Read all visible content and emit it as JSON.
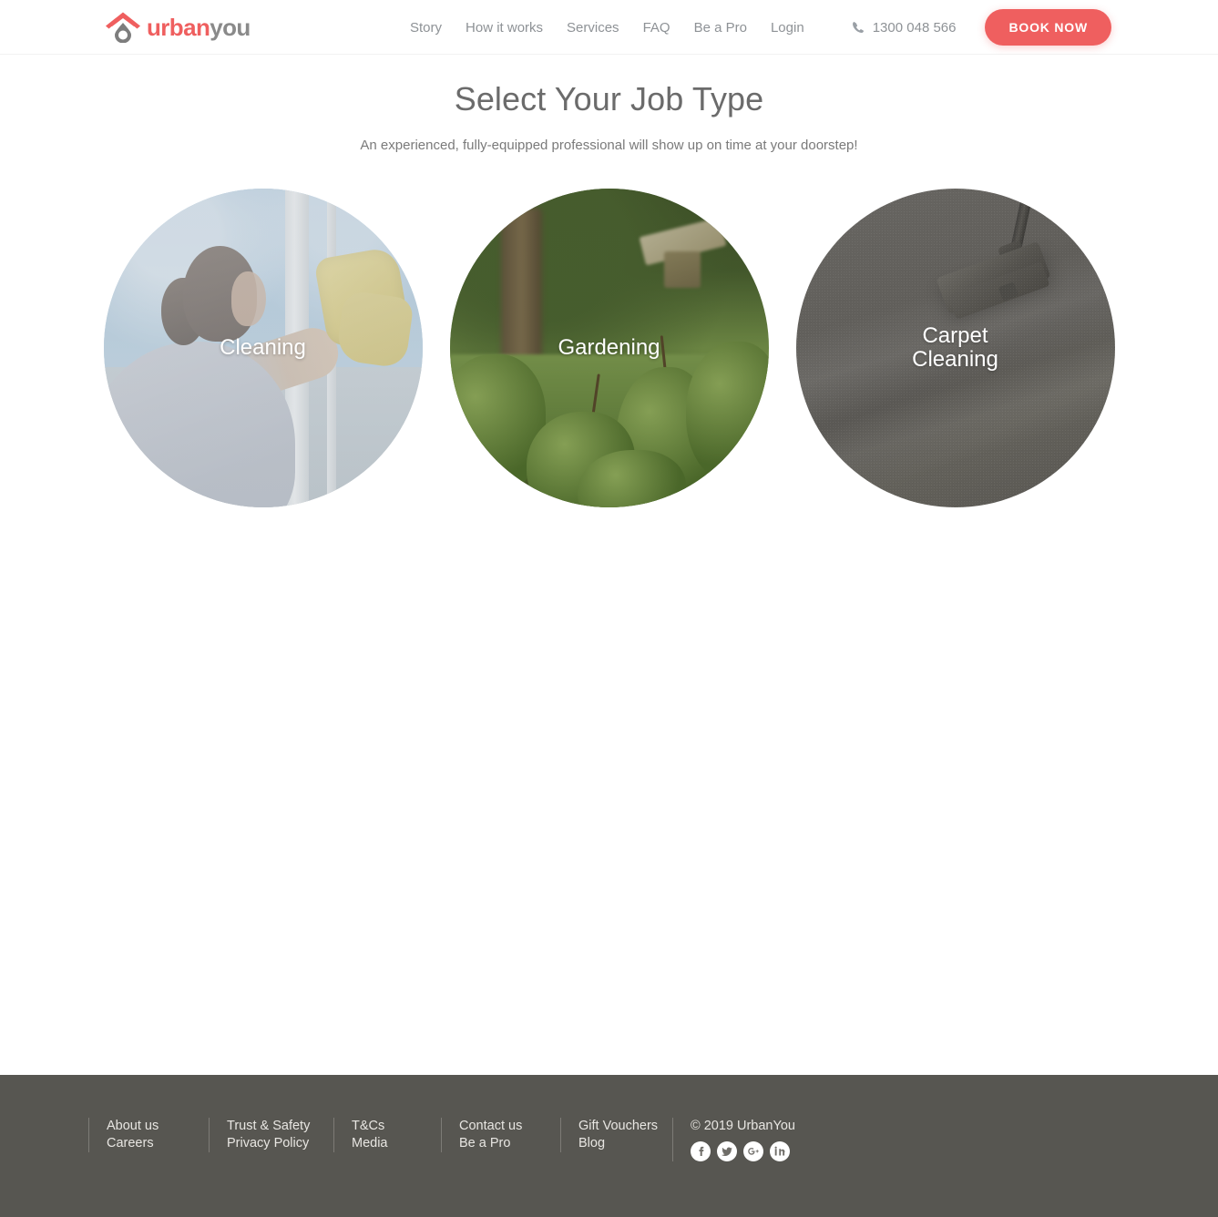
{
  "header": {
    "logo": {
      "brand_part1": "urban",
      "brand_part2": "you",
      "alt": "UrbanYou"
    },
    "nav": [
      {
        "label": "Story"
      },
      {
        "label": "How it works"
      },
      {
        "label": "Services"
      },
      {
        "label": "FAQ"
      },
      {
        "label": "Be a Pro"
      },
      {
        "label": "Login"
      }
    ],
    "phone": "1300 048 566",
    "book_now_label": "BOOK NOW",
    "accent_color": "#ef5f5f",
    "nav_text_color": "#8e9296"
  },
  "main": {
    "title": "Select Your Job Type",
    "subtitle": "An experienced, fully-equipped professional will show up on time at your doorstep!",
    "job_types": [
      {
        "label": "Cleaning",
        "image_alt": "woman-cleaning-window-with-yellow-cloth"
      },
      {
        "label": "Gardening",
        "image_alt": "green-garden-with-shrubs-and-birdhouse"
      },
      {
        "label": "Carpet\nCleaning",
        "image_alt": "vacuum-head-on-grey-carpet"
      }
    ]
  },
  "footer": {
    "background_color": "#575651",
    "columns": [
      {
        "links": [
          "About us",
          "Careers"
        ]
      },
      {
        "links": [
          "Trust & Safety",
          "Privacy Policy"
        ]
      },
      {
        "links": [
          "T&Cs",
          "Media"
        ]
      },
      {
        "links": [
          "Contact us",
          "Be a Pro"
        ]
      },
      {
        "links": [
          "Gift Vouchers",
          "Blog"
        ]
      }
    ],
    "copyright": "© 2019 UrbanYou",
    "socials": [
      {
        "name": "facebook"
      },
      {
        "name": "twitter"
      },
      {
        "name": "google-plus"
      },
      {
        "name": "linkedin"
      }
    ]
  }
}
